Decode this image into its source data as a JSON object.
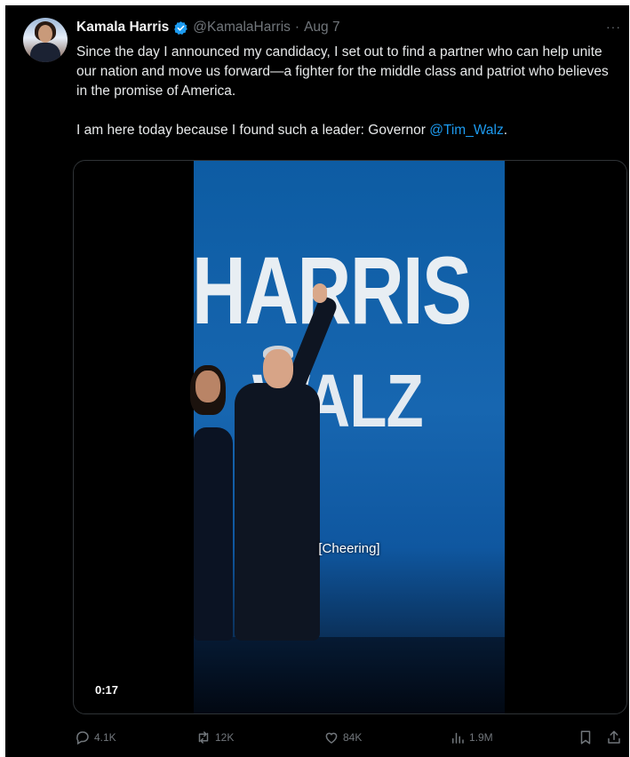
{
  "author": {
    "name": "Kamala Harris",
    "handle": "@KamalaHarris",
    "separator": "·",
    "date": "Aug 7"
  },
  "more_label": "···",
  "tweet_text": {
    "paragraph1": "Since the day I announced my candidacy, I set out to find a partner who can help unite our nation and move us forward—a fighter for the middle class and patriot who believes in the promise of America.",
    "paragraph2_prefix": "I am here today because I found such a leader: Governor ",
    "mention": "@Tim_Walz",
    "paragraph2_suffix": "."
  },
  "video": {
    "sign_line1": "HARRIS",
    "sign_line2": "WALZ",
    "caption": "[Cheering]",
    "timestamp": "0:17"
  },
  "actions": {
    "replies": "4.1K",
    "reposts": "12K",
    "likes": "84K",
    "views": "1.9M"
  },
  "colors": {
    "background": "#000000",
    "text": "#e7e9ea",
    "muted": "#71767b",
    "link": "#1d9bf0",
    "verified_badge": "#1d9bf0"
  },
  "icons": [
    "verified-badge-icon",
    "more-icon",
    "reply-icon",
    "repost-icon",
    "like-icon",
    "views-icon",
    "bookmark-icon",
    "share-icon"
  ]
}
